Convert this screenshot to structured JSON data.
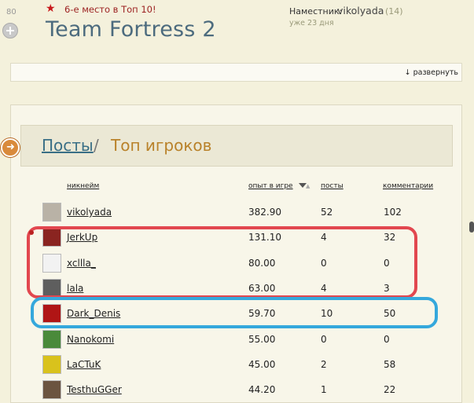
{
  "header": {
    "score": "80",
    "rank_text": "6-е место в Топ 10!",
    "title": "Team Fortress 2",
    "deputy_label": "Наместник:",
    "deputy_name": "vikolyada",
    "deputy_count": "(14)",
    "deputy_time": "уже 23 дня",
    "expand_label": "↓ развернуть"
  },
  "section": {
    "link": "Посты",
    "separator": "/",
    "current": "Топ игроков"
  },
  "table": {
    "columns": [
      "никнейм",
      "опыт в игре",
      "посты",
      "комментарии"
    ],
    "rows": [
      {
        "nick": "vikolyada",
        "exp": "382.90",
        "posts": "52",
        "comments": "102",
        "avatar_color": "#b9b2a6"
      },
      {
        "nick": "JerkUp",
        "exp": "131.10",
        "posts": "4",
        "comments": "32",
        "avatar_color": "#8a2420"
      },
      {
        "nick": "xclllа_",
        "exp": "80.00",
        "posts": "0",
        "comments": "0",
        "avatar_color": "#f2f2f2"
      },
      {
        "nick": "lala",
        "exp": "63.00",
        "posts": "4",
        "comments": "3",
        "avatar_color": "#5e5e5e"
      },
      {
        "nick": "Dark_Denis",
        "exp": "59.70",
        "posts": "10",
        "comments": "50",
        "avatar_color": "#b01515"
      },
      {
        "nick": "Nanokomi",
        "exp": "55.00",
        "posts": "0",
        "comments": "0",
        "avatar_color": "#4a8a3a"
      },
      {
        "nick": "LaCTuK",
        "exp": "45.00",
        "posts": "2",
        "comments": "58",
        "avatar_color": "#d9c21c"
      },
      {
        "nick": "TesthuGGer",
        "exp": "44.20",
        "posts": "1",
        "comments": "22",
        "avatar_color": "#6b5440"
      }
    ]
  },
  "colors": {
    "annotation_red": "#e2474f",
    "annotation_blue": "#35a8dc",
    "title": "#4c6b7e",
    "accent": "#b9822a"
  }
}
